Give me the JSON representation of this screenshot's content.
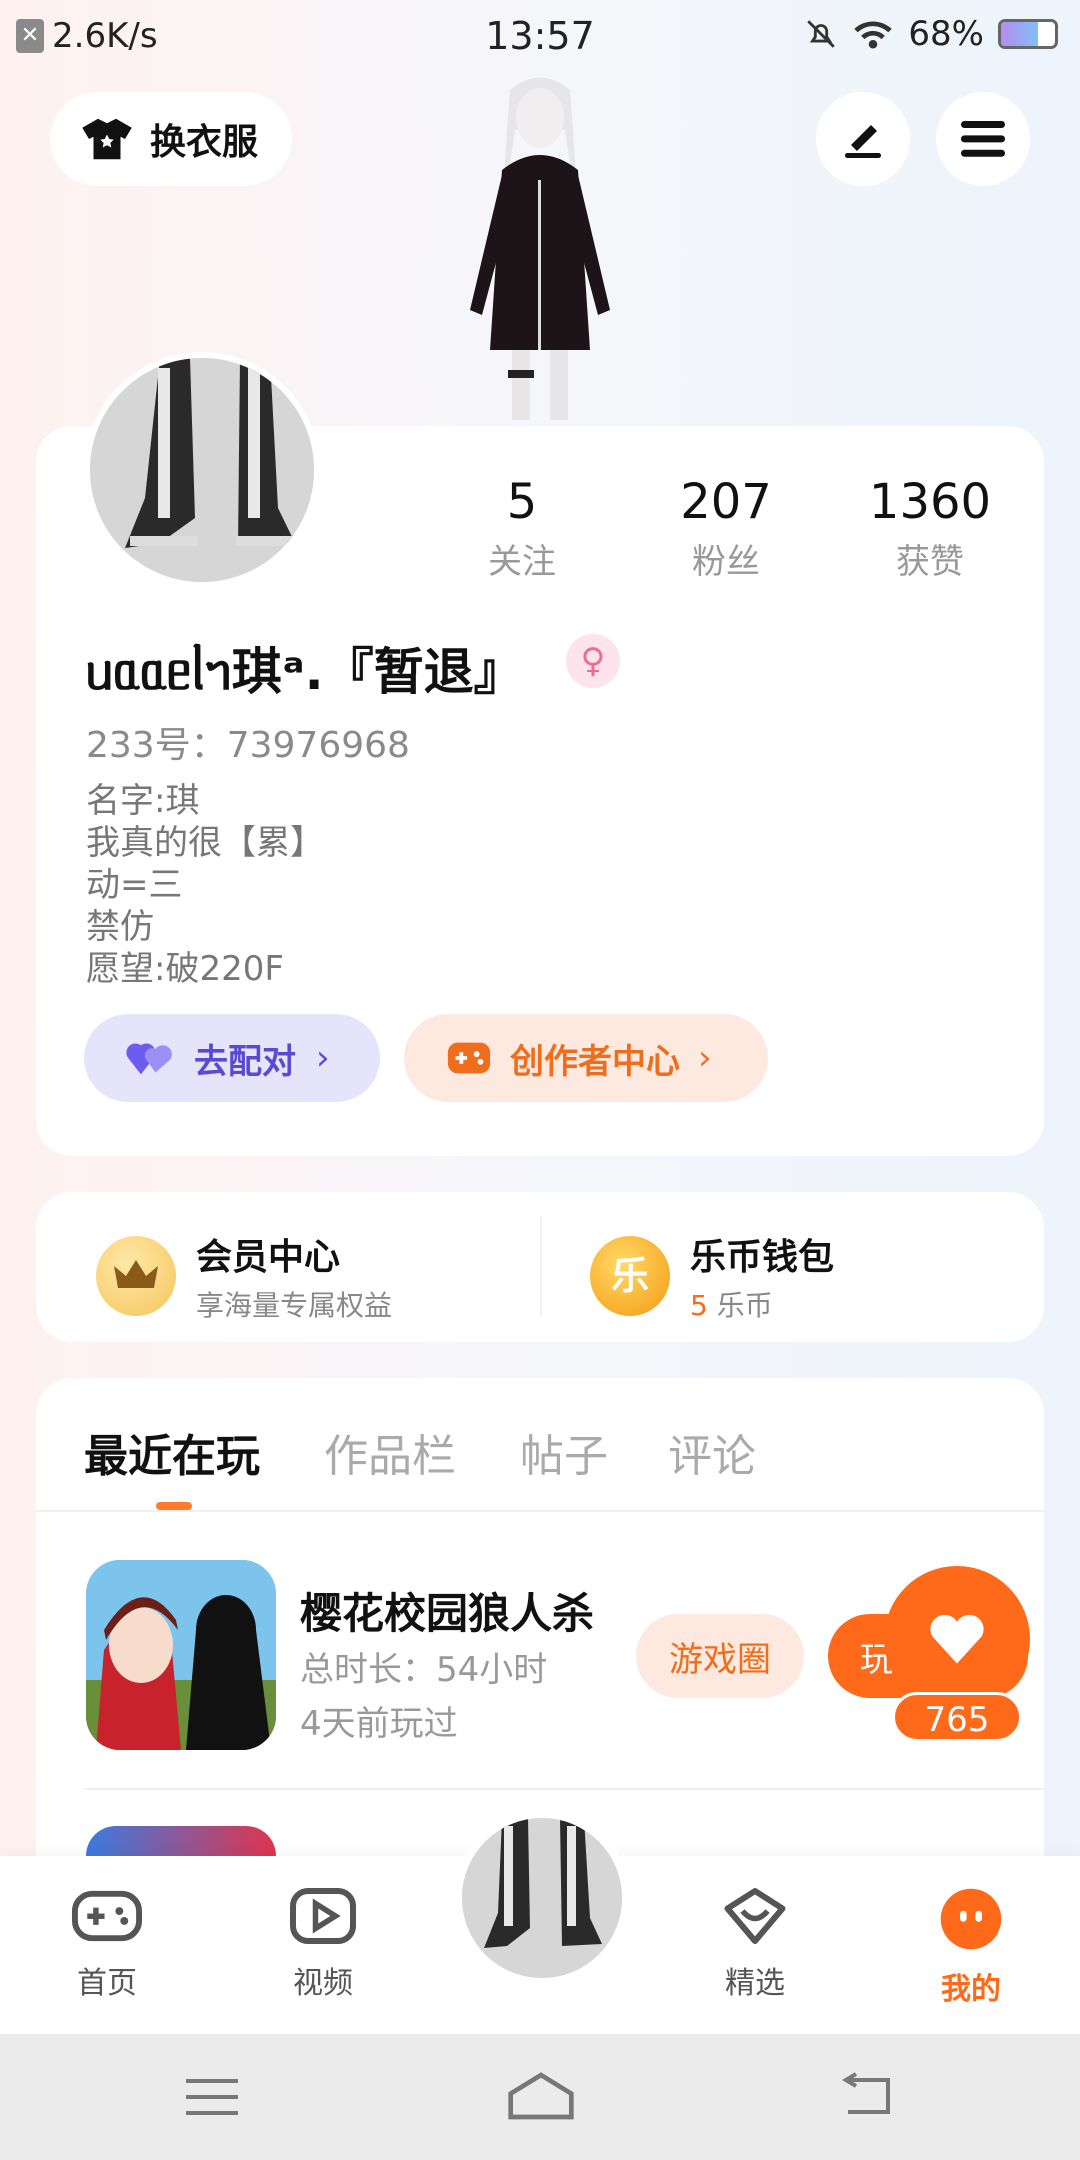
{
  "status_bar": {
    "net_speed": "2.6K/s",
    "time": "13:57",
    "battery_pct": "68%",
    "battery_level": 0.68
  },
  "header": {
    "outfit_label": "换衣服"
  },
  "profile": {
    "stats": [
      {
        "num": "5",
        "label": "关注"
      },
      {
        "num": "207",
        "label": "粉丝"
      },
      {
        "num": "1360",
        "label": "获赞"
      }
    ],
    "nickname": "ᥙᥲᥲᥱᥣᥐ琪ᵃ.『暂退』",
    "gender_symbol": "♀",
    "uid": "233号：73976968",
    "bio": [
      "名字:琪",
      "我真的很【累】",
      "动=三",
      "禁仿",
      "愿望:破220F"
    ],
    "match_label": "去配对",
    "creator_label": "创作者中心"
  },
  "member": {
    "vip_title": "会员中心",
    "vip_sub": "享海量专属权益",
    "wallet_title": "乐币钱包",
    "wallet_coin_glyph": "乐",
    "wallet_amount": "5",
    "wallet_unit": "乐币"
  },
  "tabs": [
    "最近在玩",
    "作品栏",
    "帖子",
    "评论"
  ],
  "recent_game": {
    "name": "樱花校园狼人杀",
    "duration": "总时长：54小时",
    "last_played": "4天前玩过",
    "forum_label": "游戏圈",
    "play_label": "玩",
    "like_count": "765"
  },
  "bottom_nav": [
    {
      "label": "首页",
      "icon": "gamepad-icon"
    },
    {
      "label": "视频",
      "icon": "play-icon"
    },
    {
      "label": "精选",
      "icon": "heart-badge-icon"
    },
    {
      "label": "我的",
      "icon": "face-icon"
    }
  ],
  "colors": {
    "accent": "#ff6a1a",
    "match_purple": "#5a4ad1",
    "gender_pink": "#f06c93"
  }
}
